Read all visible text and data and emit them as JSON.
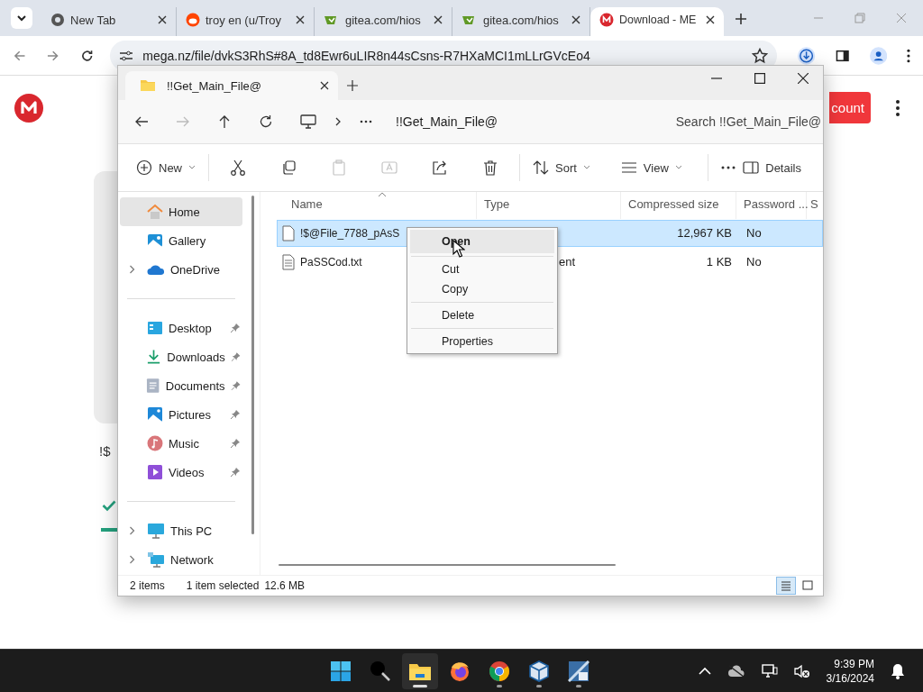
{
  "browser": {
    "tabs": [
      {
        "title": "New Tab",
        "kind": "chrome",
        "selected": false
      },
      {
        "title": "troy en (u/Troy",
        "kind": "reddit",
        "selected": false
      },
      {
        "title": "gitea.com/hios",
        "kind": "gitea",
        "selected": false
      },
      {
        "title": "gitea.com/hios",
        "kind": "gitea",
        "selected": false
      },
      {
        "title": "Download - ME",
        "kind": "mega",
        "selected": true
      }
    ],
    "url": "mega.nz/file/dvkS3RhS#8A_td8Ewr6uLIR8n44sCsns-R7HXaMCI1mLLrGVcEo4"
  },
  "page": {
    "account_button": "count",
    "file_name": "!$"
  },
  "explorer": {
    "tab_title": "!!Get_Main_File@",
    "breadcrumb": "!!Get_Main_File@",
    "search": {
      "placeholder": "Search !!Get_Main_File@"
    },
    "toolbar": [
      [
        {
          "kind": "new",
          "label": "New",
          "disabled": false
        }
      ],
      [
        {
          "kind": "cut",
          "disabled": false
        },
        {
          "kind": "copy",
          "disabled": false
        },
        {
          "kind": "paste",
          "disabled": true
        },
        {
          "kind": "rename",
          "disabled": true
        },
        {
          "kind": "share",
          "disabled": false
        },
        {
          "kind": "delete",
          "disabled": false
        }
      ],
      [
        {
          "kind": "sort",
          "label": "Sort",
          "disabled": false
        },
        {
          "kind": "view",
          "label": "View",
          "disabled": false
        }
      ],
      [
        {
          "kind": "more",
          "disabled": false
        }
      ]
    ],
    "details_button": "Details",
    "sidebar": [
      [
        {
          "label": "Home",
          "kind": "home",
          "selected": true,
          "pinned": false,
          "expandable": false
        },
        {
          "label": "Gallery",
          "kind": "gallery",
          "selected": false,
          "pinned": false,
          "expandable": false
        },
        {
          "label": "OneDrive",
          "kind": "cloud",
          "selected": false,
          "pinned": false,
          "expandable": true
        }
      ],
      [
        {
          "label": "Desktop",
          "kind": "desktop",
          "selected": false,
          "pinned": true,
          "expandable": false
        },
        {
          "label": "Downloads",
          "kind": "downloads",
          "selected": false,
          "pinned": true,
          "expandable": false
        },
        {
          "label": "Documents",
          "kind": "documents",
          "selected": false,
          "pinned": true,
          "expandable": false
        },
        {
          "label": "Pictures",
          "kind": "pictures",
          "selected": false,
          "pinned": true,
          "expandable": false
        },
        {
          "label": "Music",
          "kind": "music",
          "selected": false,
          "pinned": true,
          "expandable": false
        },
        {
          "label": "Videos",
          "kind": "videos",
          "selected": false,
          "pinned": true,
          "expandable": false
        }
      ],
      [
        {
          "label": "This PC",
          "kind": "pc",
          "selected": false,
          "pinned": false,
          "expandable": true
        },
        {
          "label": "Network",
          "kind": "network",
          "selected": false,
          "pinned": false,
          "expandable": true
        }
      ]
    ],
    "columns": [
      "Name",
      "Type",
      "Compressed size",
      "Password ...",
      "S"
    ],
    "rows": [
      {
        "name": "!$@File_7788_pAsS",
        "kind": "file",
        "compressed_size": "12,967 KB",
        "password": "No",
        "selected": true
      },
      {
        "name": "PaSSCod.txt",
        "kind": "text",
        "type": "ent",
        "compressed_size": "1 KB",
        "password": "No",
        "selected": false
      }
    ],
    "context_menu": [
      [
        {
          "label": "Open",
          "highlighted": true
        }
      ],
      [
        {
          "label": "Cut",
          "highlighted": false
        },
        {
          "label": "Copy",
          "highlighted": false
        }
      ],
      [
        {
          "label": "Delete",
          "highlighted": false
        }
      ],
      [
        {
          "label": "Properties",
          "highlighted": false
        }
      ]
    ],
    "status": {
      "count": "2 items",
      "selection": "1 item selected",
      "size": "12.6 MB"
    },
    "views": [
      {
        "kind": "details",
        "selected": true
      },
      {
        "kind": "tiles",
        "selected": false
      }
    ]
  },
  "taskbar": {
    "apps": [
      {
        "kind": "start",
        "active": false,
        "running": false
      },
      {
        "kind": "search",
        "active": false,
        "running": false
      },
      {
        "kind": "explorer",
        "active": true,
        "running": true
      },
      {
        "kind": "firefox",
        "active": false,
        "running": false
      },
      {
        "kind": "chrome",
        "active": false,
        "running": true
      },
      {
        "kind": "box",
        "active": false,
        "running": true
      },
      {
        "kind": "app",
        "active": false,
        "running": true
      }
    ],
    "time": "9:39 PM",
    "date": "3/16/2024"
  }
}
